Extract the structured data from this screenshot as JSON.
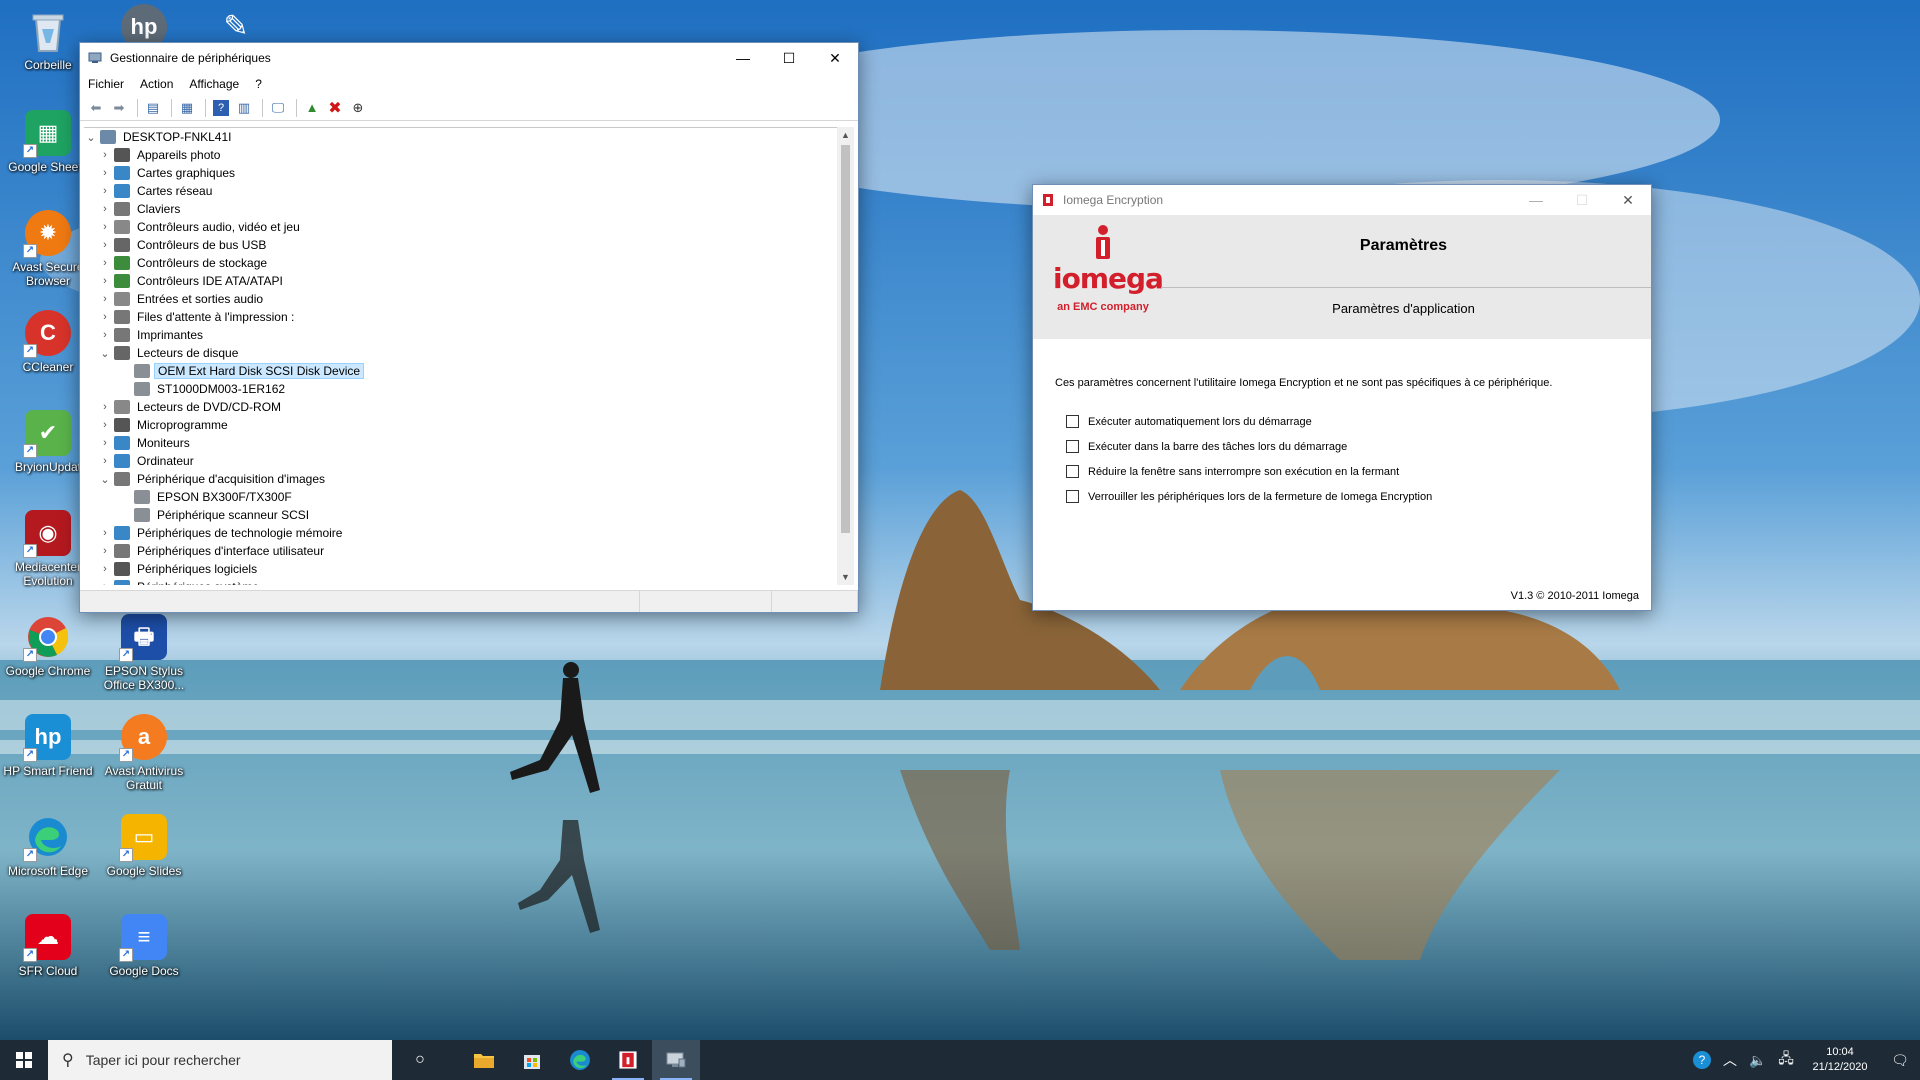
{
  "desktop": {
    "icons": [
      {
        "label": "Corbeille",
        "icon": "recycle-bin-icon",
        "color": "#8aa6bf"
      },
      {
        "label": "Google Sheets",
        "icon": "google-sheets-icon",
        "color": "#1ea362"
      },
      {
        "label": "Avast Secure Browser",
        "icon": "avast-browser-icon",
        "color": "#f07a12"
      },
      {
        "label": "CCleaner",
        "icon": "ccleaner-icon",
        "color": "#d8332a"
      },
      {
        "label": "BryionUpdat",
        "icon": "updater-icon",
        "color": "#5ab34a"
      },
      {
        "label": "Mediacenter Evolution",
        "icon": "mediacenter-icon",
        "color": "#b3191f"
      },
      {
        "label": "Google Chrome",
        "icon": "chrome-icon",
        "color": "#e6453a"
      },
      {
        "label": "HP Smart Friend",
        "icon": "hp-smart-friend-icon",
        "color": "#1b8fd6"
      },
      {
        "label": "Microsoft Edge",
        "icon": "edge-icon",
        "color": "#1a8bd0"
      },
      {
        "label": "SFR Cloud",
        "icon": "sfr-cloud-icon",
        "color": "#e2001a"
      },
      {
        "label": "EPSON Stylus Office BX300...",
        "icon": "epson-printer-icon",
        "color": "#1d4ea8"
      },
      {
        "label": "Avast Antivirus Gratuit",
        "icon": "avast-antivirus-icon",
        "color": "#f47b20"
      },
      {
        "label": "Google Slides",
        "icon": "google-slides-icon",
        "color": "#f4b400"
      },
      {
        "label": "Google Docs",
        "icon": "google-docs-icon",
        "color": "#4285f4"
      }
    ]
  },
  "devmgr": {
    "title": "Gestionnaire de périphériques",
    "menu": [
      "Fichier",
      "Action",
      "Affichage",
      "?"
    ],
    "root": "DESKTOP-FNKL41I",
    "categories": [
      {
        "label": "Appareils photo",
        "expanded": false,
        "color": "#555"
      },
      {
        "label": "Cartes graphiques",
        "expanded": false,
        "color": "#3a87c8"
      },
      {
        "label": "Cartes réseau",
        "expanded": false,
        "color": "#3a87c8"
      },
      {
        "label": "Claviers",
        "expanded": false,
        "color": "#777"
      },
      {
        "label": "Contrôleurs audio, vidéo et jeu",
        "expanded": false,
        "color": "#888"
      },
      {
        "label": "Contrôleurs de bus USB",
        "expanded": false,
        "color": "#666"
      },
      {
        "label": "Contrôleurs de stockage",
        "expanded": false,
        "color": "#3c8c3c"
      },
      {
        "label": "Contrôleurs IDE ATA/ATAPI",
        "expanded": false,
        "color": "#3c8c3c"
      },
      {
        "label": "Entrées et sorties audio",
        "expanded": false,
        "color": "#888"
      },
      {
        "label": "Files d'attente à l'impression :",
        "expanded": false,
        "color": "#777"
      },
      {
        "label": "Imprimantes",
        "expanded": false,
        "color": "#777"
      },
      {
        "label": "Lecteurs de disque",
        "expanded": true,
        "color": "#666",
        "children": [
          {
            "label": "OEM  Ext Hard Disk SCSI Disk Device",
            "selected": true
          },
          {
            "label": "ST1000DM003-1ER162",
            "selected": false
          }
        ]
      },
      {
        "label": "Lecteurs de DVD/CD-ROM",
        "expanded": false,
        "color": "#888"
      },
      {
        "label": "Microprogramme",
        "expanded": false,
        "color": "#555"
      },
      {
        "label": "Moniteurs",
        "expanded": false,
        "color": "#3a87c8"
      },
      {
        "label": "Ordinateur",
        "expanded": false,
        "color": "#3a87c8"
      },
      {
        "label": "Périphérique d'acquisition d'images",
        "expanded": true,
        "color": "#777",
        "children": [
          {
            "label": "EPSON BX300F/TX300F",
            "selected": false
          },
          {
            "label": "Périphérique scanneur SCSI",
            "selected": false
          }
        ]
      },
      {
        "label": "Périphériques de technologie mémoire",
        "expanded": false,
        "color": "#3a87c8"
      },
      {
        "label": "Périphériques d'interface utilisateur",
        "expanded": false,
        "color": "#777"
      },
      {
        "label": "Périphériques logiciels",
        "expanded": false,
        "color": "#555"
      },
      {
        "label": "Périphériques système",
        "expanded": false,
        "color": "#3a87c8"
      }
    ]
  },
  "iomega": {
    "title": "Iomega Encryption",
    "brand": "iomega",
    "brand_sub": "an EMC company",
    "header_title": "Paramètres",
    "header_subtitle": "Paramètres d'application",
    "description": "Ces paramètres concernent l'utilitaire Iomega Encryption et ne sont pas spécifiques à ce périphérique.",
    "options": [
      {
        "label": "Exécuter automatiquement lors du démarrage",
        "checked": false
      },
      {
        "label": "Exécuter dans la barre des tâches lors du démarrage",
        "checked": false
      },
      {
        "label": "Réduire la fenêtre sans interrompre son exécution en la fermant",
        "checked": false
      },
      {
        "label": "Verrouiller les périphériques lors de la fermeture de Iomega Encryption",
        "checked": false
      }
    ],
    "version": "V1.3 © 2010-2011 Iomega",
    "accent": "#d21f2b"
  },
  "taskbar": {
    "search_placeholder": "Taper ici pour rechercher",
    "time": "10:04",
    "date": "21/12/2020"
  }
}
